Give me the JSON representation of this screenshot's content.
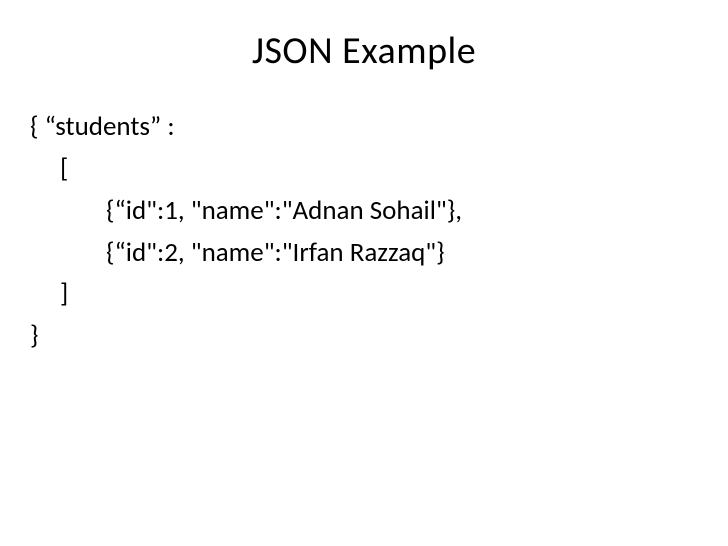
{
  "title": "JSON Example",
  "lines": [
    {
      "indent": 0,
      "text": "{ “students” :"
    },
    {
      "indent": 1,
      "text": "["
    },
    {
      "indent": 2,
      "text": "{“id\":1, \"name\":\"Adnan Sohail\"},"
    },
    {
      "indent": 2,
      "text": "{“id\":2, \"name\":\"Irfan Razzaq\"}"
    },
    {
      "indent": 1,
      "text": "]"
    },
    {
      "indent": 0,
      "text": "}"
    }
  ]
}
